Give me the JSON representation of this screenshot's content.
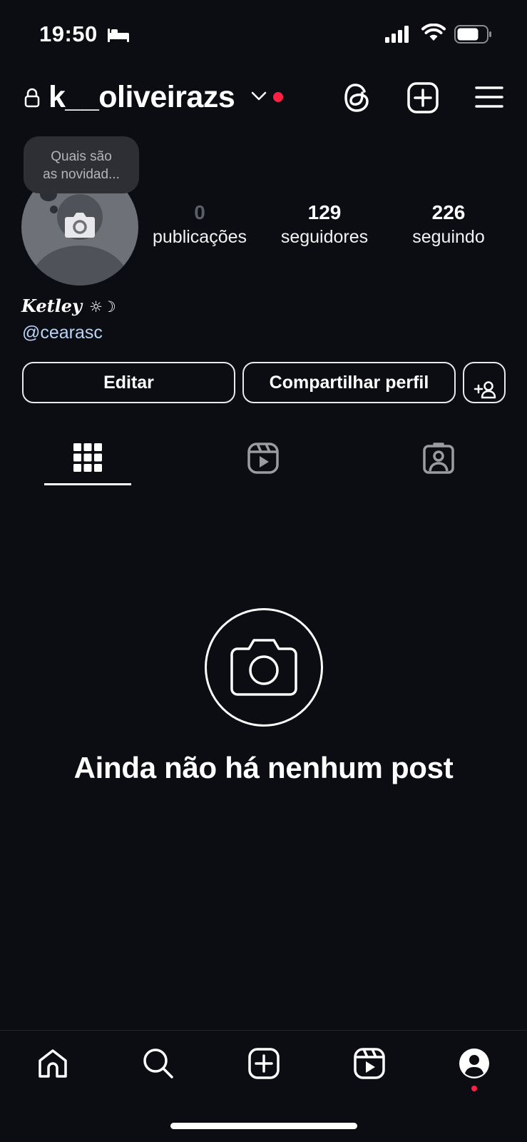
{
  "status_bar": {
    "time": "19:50",
    "icons": [
      "bed-icon",
      "signal-icon",
      "wifi-icon",
      "battery-icon"
    ]
  },
  "header": {
    "username": "k__oliveirazs",
    "icons": [
      "lock-icon",
      "chevron-down-icon",
      "threads-icon",
      "plus-square-icon",
      "menu-icon"
    ],
    "notification_color": "#ff1f45"
  },
  "profile": {
    "note_bubble_line1": "Quais são",
    "note_bubble_line2": "as novidad...",
    "stats": {
      "posts": {
        "value": "0",
        "label": "publicações"
      },
      "followers": {
        "value": "129",
        "label": "seguidores"
      },
      "following": {
        "value": "226",
        "label": "seguindo"
      }
    },
    "display_name": "Ketley",
    "display_name_emoji": "☼☽",
    "handle": "@cearasc"
  },
  "actions": {
    "edit_label": "Editar",
    "share_label": "Compartilhar perfil"
  },
  "tabs": [
    {
      "name": "grid",
      "icon": "grid-icon",
      "active": true
    },
    {
      "name": "reels",
      "icon": "reels-icon",
      "active": false
    },
    {
      "name": "tagged",
      "icon": "tagged-icon",
      "active": false
    }
  ],
  "empty_state": {
    "icon": "camera-icon",
    "title": "Ainda não há nenhum post"
  },
  "bottom_nav": {
    "items": [
      "home-icon",
      "search-icon",
      "create-icon",
      "reels-icon",
      "profile-icon"
    ]
  },
  "colors": {
    "background": "#0b0d12",
    "accent_red": "#ff1f45",
    "link": "#b9d2f5"
  }
}
